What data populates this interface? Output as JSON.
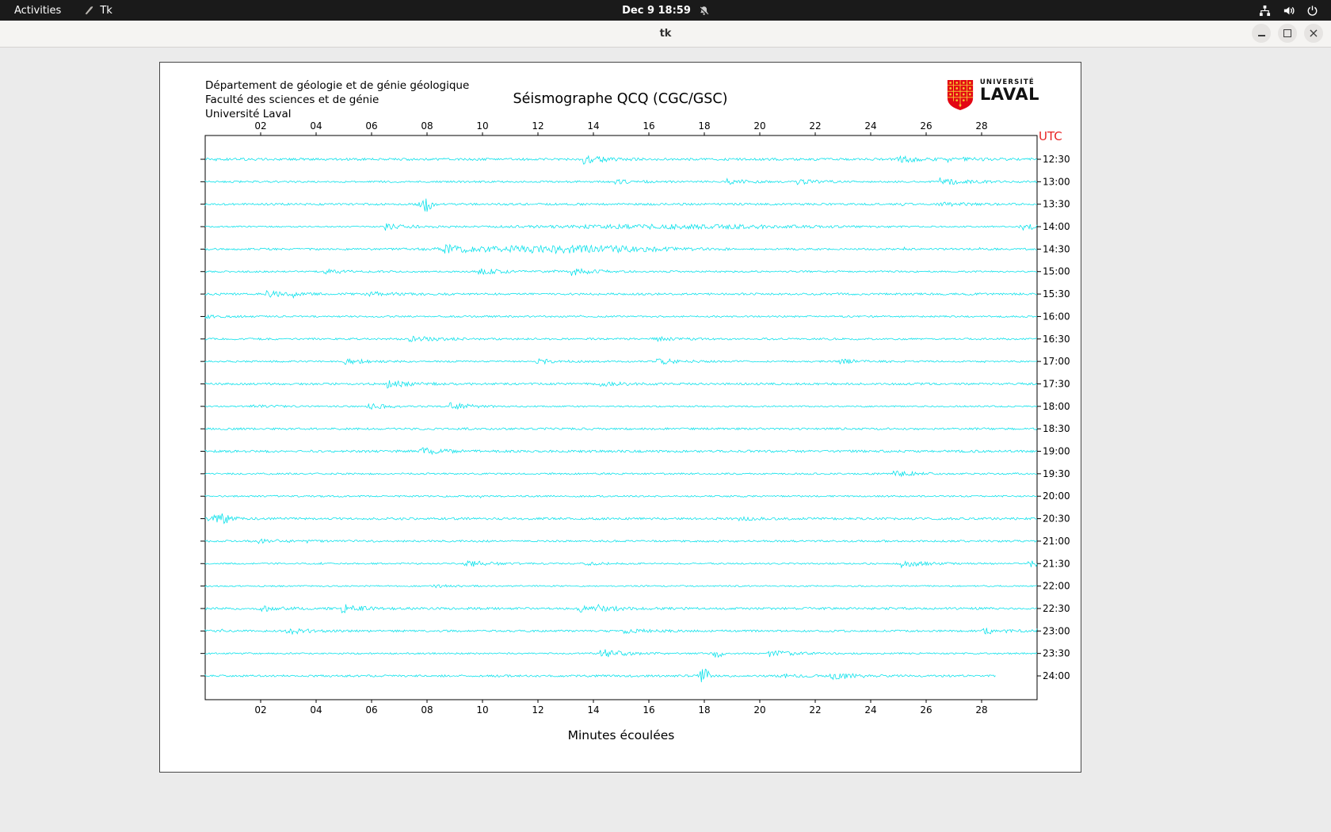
{
  "top_bar": {
    "activities_label": "Activities",
    "app_name": "Tk",
    "clock": "Dec 9 18:59"
  },
  "window": {
    "title": "tk"
  },
  "seismograph": {
    "header_lines": [
      "Département de géologie et de génie géologique",
      "Faculté des sciences et de génie",
      "Université Laval"
    ],
    "title": "Séismographe QCQ (CGC/GSC)",
    "logo": {
      "top": "UNIVERSITÉ",
      "bottom": "LAVAL"
    },
    "utc_label": "UTC",
    "xlabel": "Minutes écoulées",
    "x_ticks": [
      "02",
      "04",
      "06",
      "08",
      "10",
      "12",
      "14",
      "16",
      "18",
      "20",
      "22",
      "24",
      "26",
      "28"
    ],
    "time_labels": [
      "12:30",
      "13:00",
      "13:30",
      "14:00",
      "14:30",
      "15:00",
      "15:30",
      "16:00",
      "16:30",
      "17:00",
      "17:30",
      "18:00",
      "18:30",
      "19:00",
      "19:30",
      "20:00",
      "20:30",
      "21:00",
      "21:30",
      "22:00",
      "22:30",
      "23:00",
      "23:30",
      "24:00"
    ],
    "x_minutes_max": 30,
    "last_trace_end_min": 28.5,
    "colors": {
      "trace": "#00e0ea",
      "utc": "#e82222",
      "logo_red": "#e30613",
      "logo_gold": "#f2c230"
    },
    "bursts": [
      {
        "time": "13:30",
        "center": 8.0,
        "width": 0.15,
        "amp": 10
      },
      {
        "time": "14:00",
        "center": 17.0,
        "width": 4.0,
        "amp": 2.2
      },
      {
        "time": "14:30",
        "center": 13.0,
        "width": 2.5,
        "amp": 4.2
      },
      {
        "time": "20:30",
        "center": 0.6,
        "width": 0.3,
        "amp": 5
      },
      {
        "time": "23:30",
        "center": 18.5,
        "width": 0.12,
        "amp": 9
      },
      {
        "time": "24:00",
        "center": 18.0,
        "width": 0.12,
        "amp": 11
      }
    ]
  }
}
